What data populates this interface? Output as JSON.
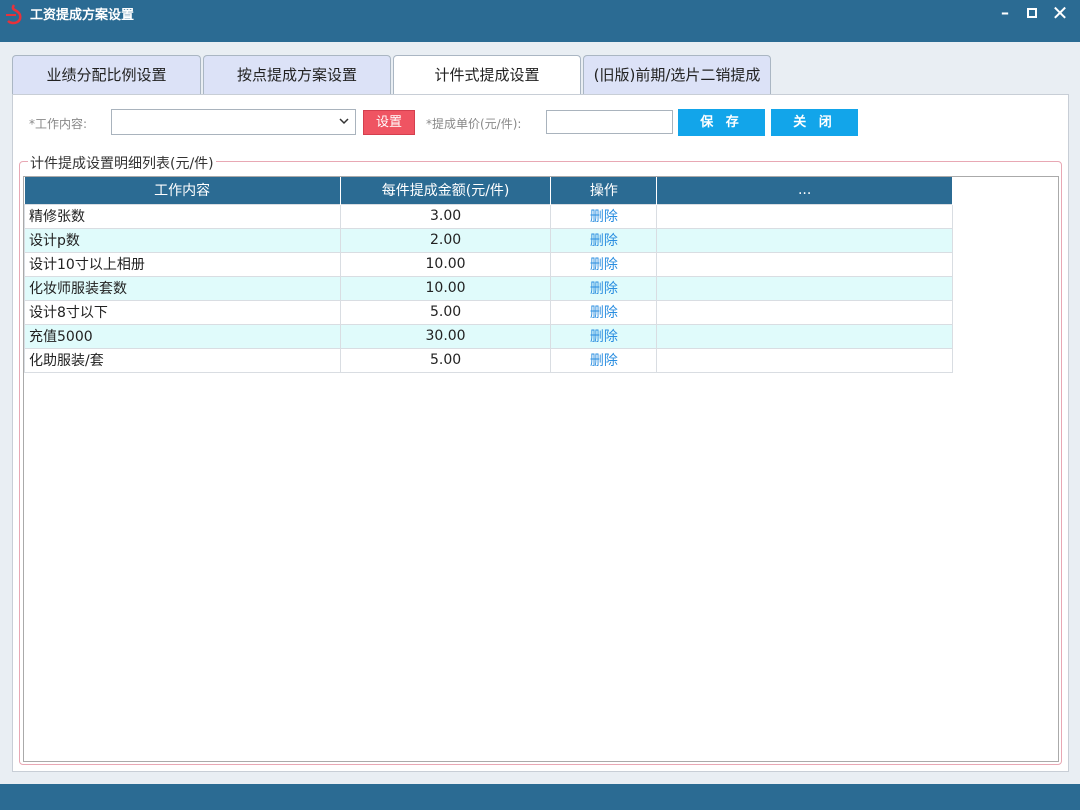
{
  "window": {
    "title": "工资提成方案设置",
    "icon": "app-logo-icon",
    "minimize_glyph": "–",
    "close_glyph": "✕"
  },
  "tabs": [
    {
      "label": "业绩分配比例设置",
      "active": false
    },
    {
      "label": "按点提成方案设置",
      "active": false
    },
    {
      "label": "计件式提成设置",
      "active": true
    },
    {
      "label": "(旧版)前期/选片二销提成",
      "active": false
    }
  ],
  "form": {
    "work_content_label": "*工作内容:",
    "work_content_value": "",
    "set_button": "设置",
    "unit_price_label": "*提成单价(元/件):",
    "unit_price_value": "",
    "save_button": "保 存",
    "close_button": "关 闭"
  },
  "group": {
    "legend": "计件提成设置明细列表(元/件)"
  },
  "table": {
    "headers": [
      "工作内容",
      "每件提成金额(元/件)",
      "操作",
      "..."
    ],
    "rows": [
      {
        "name": "精修张数",
        "amount": "3.00",
        "action": "删除"
      },
      {
        "name": "设计p数",
        "amount": "2.00",
        "action": "删除"
      },
      {
        "name": "设计10寸以上相册",
        "amount": "10.00",
        "action": "删除"
      },
      {
        "name": "化妆师服装套数",
        "amount": "10.00",
        "action": "删除"
      },
      {
        "name": "设计8寸以下",
        "amount": "5.00",
        "action": "删除"
      },
      {
        "name": "充值5000",
        "amount": "30.00",
        "action": "删除"
      },
      {
        "name": "化助服装/套",
        "amount": "5.00",
        "action": "删除"
      }
    ]
  },
  "colors": {
    "titlebar": "#2b6b93",
    "header": "#2b6b93",
    "set_button": "#ef5462",
    "blue_button": "#12a5ea",
    "alt_row": "#e0fbfb",
    "link": "#2a8ee0"
  }
}
